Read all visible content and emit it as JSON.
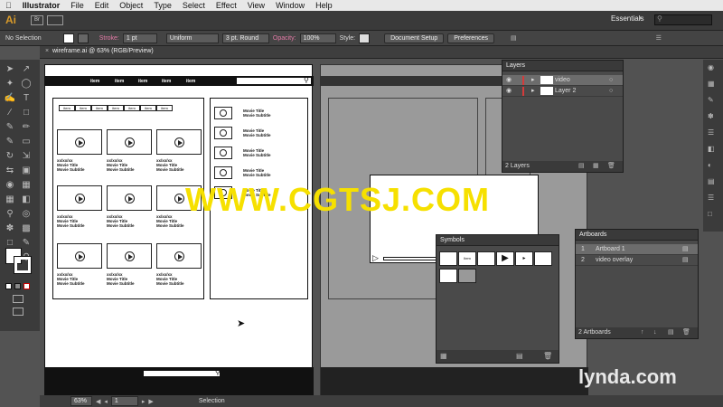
{
  "menubar": {
    "apple": "",
    "app": "Illustrator",
    "items": [
      "File",
      "Edit",
      "Object",
      "Type",
      "Select",
      "Effect",
      "View",
      "Window",
      "Help"
    ]
  },
  "appbar": {
    "logo": "Ai",
    "br": "Br",
    "workspace": "Essentials"
  },
  "control": {
    "selection": "No Selection",
    "stroke_label": "Stroke:",
    "stroke_value": "1 pt",
    "profile": "Uniform",
    "brush": "3 pt. Round",
    "opacity_label": "Opacity:",
    "opacity_value": "100%",
    "style_label": "Style:",
    "document_setup": "Document Setup",
    "preferences": "Preferences"
  },
  "document": {
    "tab": "wireframe.ai @ 63% (RGB/Preview)"
  },
  "wireframe": {
    "nav": [
      "item",
      "item",
      "item",
      "item",
      "item"
    ],
    "tabs": [
      "item",
      "item",
      "item",
      "item",
      "item",
      "item",
      "item"
    ],
    "video_caption": "xx/xx/xx\nMovie Title\nMovie Subtitle",
    "side_caption": "Movie Title\nMovie Subtitle"
  },
  "layers": {
    "title": "Layers",
    "rows": [
      "video",
      "Layer 2"
    ],
    "footer": "2 Layers"
  },
  "artboards": {
    "title": "Artboards",
    "rows": [
      {
        "num": "1",
        "name": "Artboard 1"
      },
      {
        "num": "2",
        "name": "video overlay"
      }
    ],
    "footer": "2 Artboards"
  },
  "symbols": {
    "title": "Symbols",
    "tile_label": "Item"
  },
  "status": {
    "zoom": "63%",
    "page": "1",
    "tool": "Selection"
  },
  "watermark": "WWW.CGTSJ.COM",
  "brand": "lynda.com"
}
